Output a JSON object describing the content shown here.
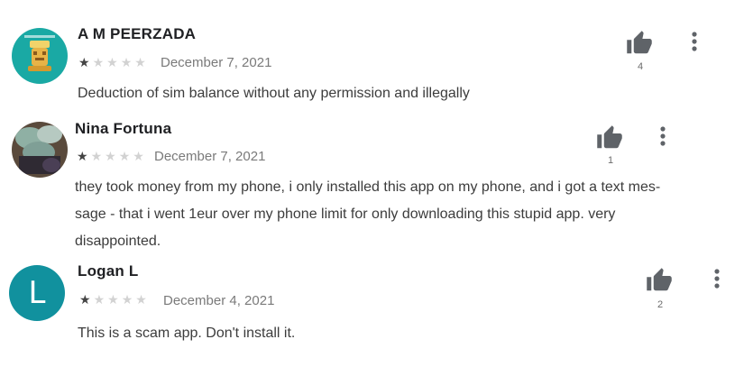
{
  "reviews": [
    {
      "name": "A M PEERZADA",
      "rating": 1,
      "date": "December 7, 2021",
      "text": "Deduction of sim balance without any permission and illegally",
      "helpful_count": "4",
      "avatar_icon": "game-cover-avatar"
    },
    {
      "name": "Nina Fortuna",
      "rating": 1,
      "date": "December 7, 2021",
      "text": "they took money from my phone, i only installed this app on my phone, and i got a text mes-sage - that i went 1eur over my phone limit for only downloading this stupid app. very disappointed.",
      "text_lines": [
        "they took money from my phone, i only installed this app on my phone, and i got a text mes-",
        "sage - that i went 1eur over my phone limit for only downloading this stupid app. very",
        "disappointed."
      ],
      "helpful_count": "1",
      "avatar_icon": "photo-avatar"
    },
    {
      "name": "Logan L",
      "rating": 1,
      "date": "December 4, 2021",
      "text": "This is a scam app. Don't install it.",
      "helpful_count": "2",
      "avatar_letter": "L",
      "avatar_color": "#11919e"
    }
  ],
  "star_max": 5,
  "icons": {
    "helpful": "thumb-up-icon",
    "menu": "more-vert-icon",
    "star": "star-icon"
  },
  "colors": {
    "star_filled": "#444444",
    "star_empty": "#d2d2d2",
    "icon_gray": "#5f6368"
  }
}
